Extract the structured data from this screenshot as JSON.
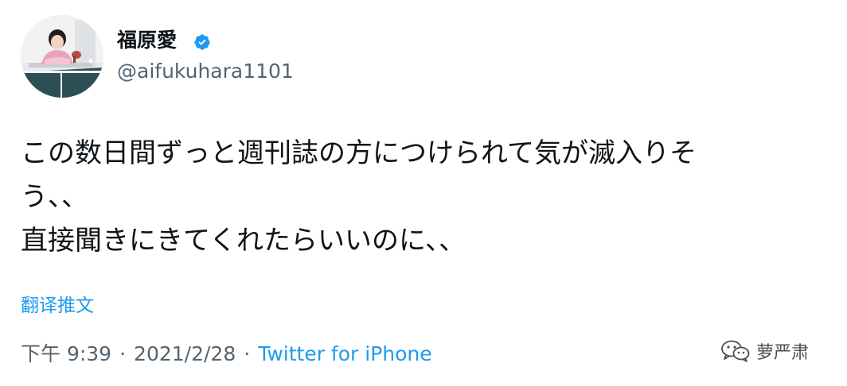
{
  "tweet": {
    "display_name": "福原愛",
    "handle": "@aifukuhara1101",
    "text_lines": [
      "この数日間ずっと週刊誌の方につけられて気が滅入りそ",
      "う、、",
      "直接聞きにきてくれたらいいのに、、"
    ],
    "translate_label": "翻译推文",
    "time": "下午 9:39",
    "date": "2021/2/28",
    "separator": "·",
    "source": "Twitter for iPhone"
  },
  "watermark": {
    "text": "萝严肃"
  },
  "icons": {
    "verified": "verified-badge-icon",
    "wechat": "wechat-icon"
  },
  "colors": {
    "link": "#1d9bf0",
    "secondary": "#536471",
    "primary_text": "#0f1419"
  }
}
